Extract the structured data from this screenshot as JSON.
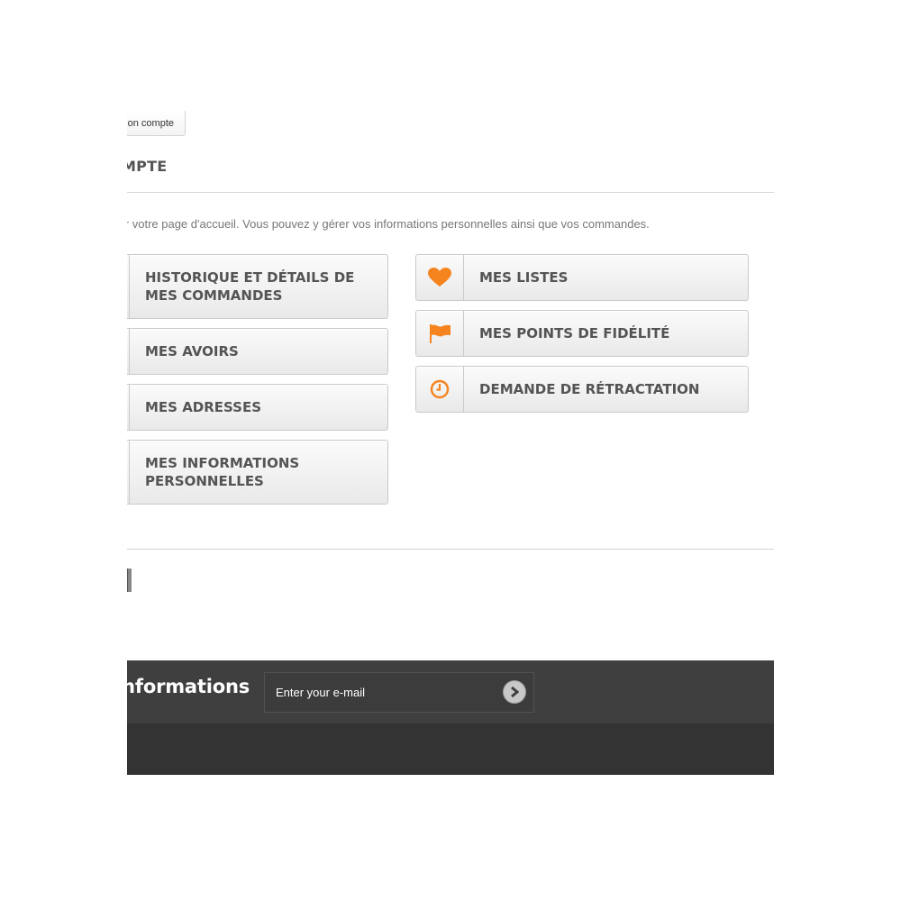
{
  "header": {
    "back_button_label": "Mon compte"
  },
  "page": {
    "title": "MON COMPTE",
    "intro": "Bienvenue sur votre page d'accueil. Vous pouvez y gérer vos informations personnelles ainsi que vos commandes."
  },
  "account_links": {
    "left": [
      {
        "label": "Historique et détails de mes commandes",
        "icon": "list-icon"
      },
      {
        "label": "Mes avoirs",
        "icon": "credit-slip-icon"
      },
      {
        "label": "Mes adresses",
        "icon": "building-icon"
      },
      {
        "label": "Mes informations personnelles",
        "icon": "user-icon"
      }
    ],
    "right": [
      {
        "label": "Mes listes",
        "icon": "heart-icon"
      },
      {
        "label": "Mes points de fidélité",
        "icon": "flag-icon"
      },
      {
        "label": "Demande de rétractation",
        "icon": "clock-icon"
      }
    ]
  },
  "newsletter": {
    "title": "Lettre d'informations",
    "placeholder": "Enter your e-mail",
    "submit_icon": "chevron-right-icon"
  },
  "colors": {
    "accent": "#f5841f",
    "text": "#555454",
    "footer_top": "#3f3f3f",
    "footer_bottom": "#333333"
  }
}
